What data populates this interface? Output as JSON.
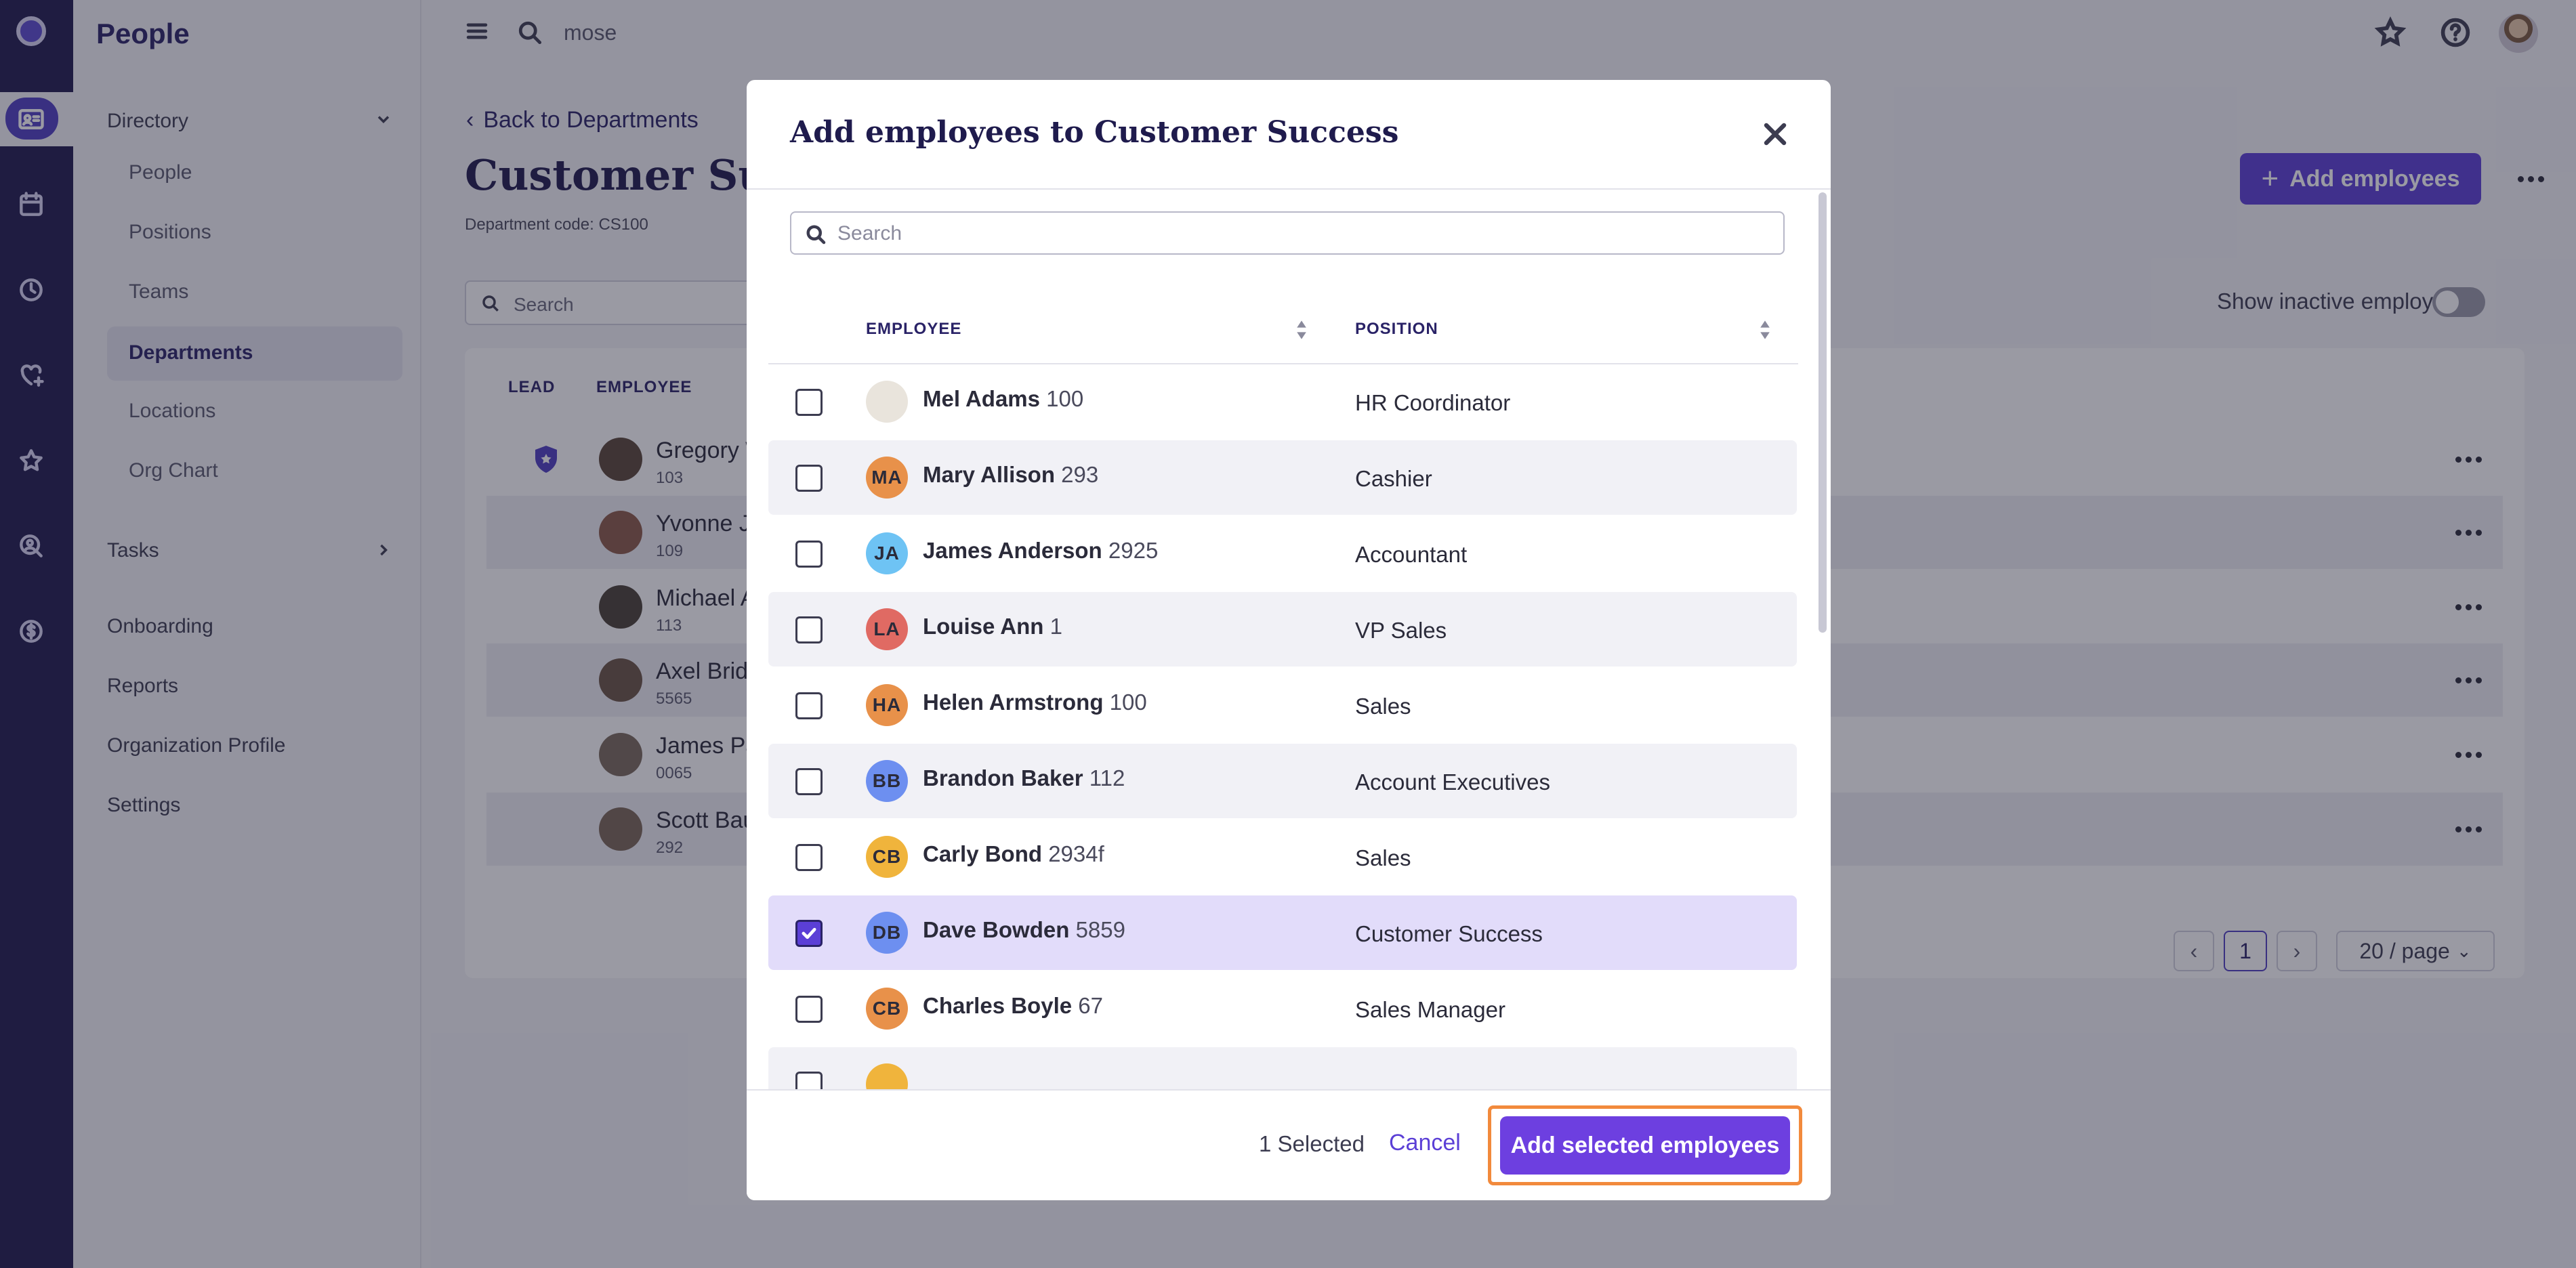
{
  "app": {
    "title": "People"
  },
  "topbar": {
    "search_value": "mose"
  },
  "sidebar": {
    "directory": {
      "label": "Directory",
      "items": [
        "People",
        "Positions",
        "Teams",
        "Departments",
        "Locations",
        "Org Chart"
      ]
    },
    "sections": [
      "Tasks",
      "Onboarding",
      "Reports",
      "Organization Profile",
      "Settings"
    ]
  },
  "page": {
    "back_label": "Back to Departments",
    "title": "Customer Success",
    "department_code": "Department code: CS100",
    "search_placeholder": "Search",
    "add_button": "Add employees",
    "show_inactive_label": "Show inactive employees",
    "columns": [
      "LEAD",
      "EMPLOYEE"
    ],
    "rows": [
      {
        "name": "Gregory W",
        "id": "103",
        "lead": true
      },
      {
        "name": "Yvonne Jo",
        "id": "109"
      },
      {
        "name": "Michael A",
        "id": "113"
      },
      {
        "name": "Axel Bridg",
        "id": "5565"
      },
      {
        "name": "James Pa",
        "id": "0065"
      },
      {
        "name": "Scott Bau",
        "id": "292"
      }
    ],
    "pagination": {
      "current_page": "1",
      "page_size": "20 / page"
    }
  },
  "modal": {
    "title": "Add employees to Customer Success",
    "search_placeholder": "Search",
    "columns": {
      "employee": "EMPLOYEE",
      "position": "POSITION"
    },
    "employees": [
      {
        "name": "Mel Adams",
        "id": "100",
        "position": "HR Coordinator",
        "initials": "",
        "avatar_color": "#e9e4dc",
        "checked": false
      },
      {
        "name": "Mary Allison",
        "id": "293",
        "position": "Cashier",
        "initials": "MA",
        "avatar_color": "#e8914a",
        "checked": false
      },
      {
        "name": "James Anderson",
        "id": "2925",
        "position": "Accountant",
        "initials": "JA",
        "avatar_color": "#6ec3f4",
        "checked": false
      },
      {
        "name": "Louise Ann",
        "id": "1",
        "position": "VP Sales",
        "initials": "LA",
        "avatar_color": "#e06a63",
        "checked": false
      },
      {
        "name": "Helen Armstrong",
        "id": "100",
        "position": "Sales",
        "initials": "HA",
        "avatar_color": "#e8914a",
        "checked": false
      },
      {
        "name": "Brandon Baker",
        "id": "112",
        "position": "Account Executives",
        "initials": "BB",
        "avatar_color": "#6d8ff0",
        "checked": false
      },
      {
        "name": "Carly Bond",
        "id": "2934f",
        "position": "Sales",
        "initials": "CB",
        "avatar_color": "#f0b43c",
        "checked": false
      },
      {
        "name": "Dave Bowden",
        "id": "5859",
        "position": "Customer Success",
        "initials": "DB",
        "avatar_color": "#6d8ff0",
        "checked": true
      },
      {
        "name": "Charles Boyle",
        "id": "67",
        "position": "Sales Manager",
        "initials": "CB",
        "avatar_color": "#e8914a",
        "checked": false
      },
      {
        "name": "",
        "id": "",
        "position": "",
        "initials": "",
        "avatar_color": "#f0b43c",
        "checked": false
      }
    ],
    "selected_count": "1 Selected",
    "cancel_label": "Cancel",
    "submit_label": "Add selected employees"
  },
  "colors": {
    "brand": "#1f1b4d",
    "accent": "#5b3fd6",
    "highlight": "#f28a3c"
  }
}
